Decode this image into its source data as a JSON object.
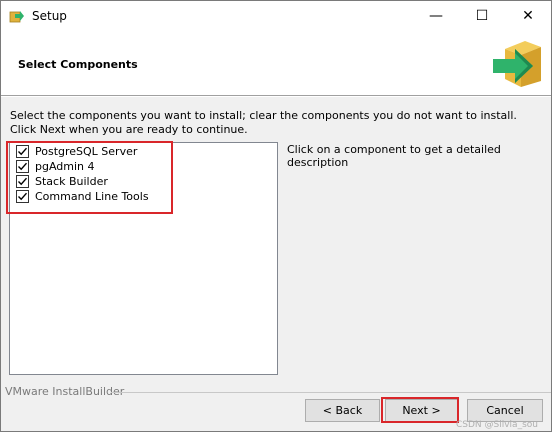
{
  "window": {
    "title": "Setup",
    "minimize_glyph": "—",
    "maximize_glyph": "☐",
    "close_glyph": "✕"
  },
  "header": {
    "title": "Select Components",
    "logo_icon": "installer-box-arrow-icon"
  },
  "instructions": "Select the components you want to install; clear the components you do not want to install. Click Next when you are ready to continue.",
  "components": [
    {
      "label": "PostgreSQL Server",
      "checked": true
    },
    {
      "label": "pgAdmin 4",
      "checked": true
    },
    {
      "label": "Stack Builder",
      "checked": true
    },
    {
      "label": "Command Line Tools",
      "checked": true
    }
  ],
  "description": "Click on a component to get a detailed description",
  "footer": {
    "brand": "VMware InstallBuilder",
    "back_label": "< Back",
    "next_label": "Next >",
    "cancel_label": "Cancel"
  },
  "watermark": "CSDN @Silvia_sou",
  "colors": {
    "highlight": "#d9262a",
    "logo_green": "#2fb36b",
    "logo_box": "#e0b23c"
  }
}
